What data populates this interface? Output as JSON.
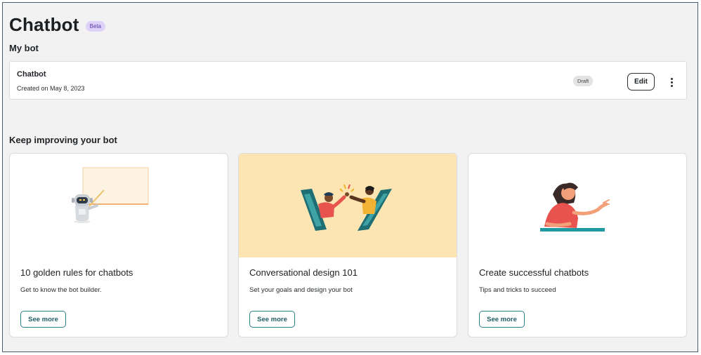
{
  "header": {
    "title": "Chatbot",
    "badge": "Beta"
  },
  "my_bot": {
    "section_title": "My bot",
    "bot": {
      "name": "Chatbot",
      "created": "Created on May 8, 2023",
      "status": "Draft",
      "edit_label": "Edit",
      "more_icon": "more-vertical-icon"
    }
  },
  "improve": {
    "section_title": "Keep improving your bot",
    "cards": [
      {
        "title": "10 golden rules for chatbots",
        "description": "Get to know the bot builder.",
        "button": "See more",
        "illustration": "robot-whiteboard"
      },
      {
        "title": "Conversational design 101",
        "description": "Set your goals and design your bot",
        "button": "See more",
        "illustration": "phones-high-five"
      },
      {
        "title": "Create successful chatbots",
        "description": "Tips and tricks to succeed",
        "button": "See more",
        "illustration": "woman-at-desk"
      }
    ]
  },
  "colors": {
    "background": "#f2f2f2",
    "accent": "#2e7f86",
    "beta_badge": "#ddd1f7",
    "card2_bg": "#fde5b3"
  }
}
